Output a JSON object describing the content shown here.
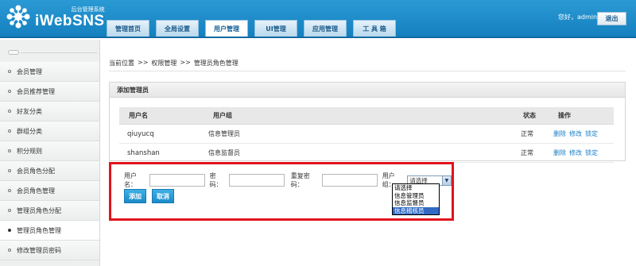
{
  "header": {
    "logo_sub": "后台管理系统",
    "logo_main": "iWebSNS",
    "tabs": [
      {
        "label": "管理首页"
      },
      {
        "label": "全局设置"
      },
      {
        "label": "用户管理"
      },
      {
        "label": "UI管理"
      },
      {
        "label": "应用管理"
      },
      {
        "label": "工 具 箱"
      }
    ],
    "active_tab": "用户管理",
    "greeting": "您好，admin",
    "logout_label": "退出"
  },
  "sidebar": {
    "items": [
      {
        "label": "会员管理"
      },
      {
        "label": "会员推荐管理"
      },
      {
        "label": "好友分类"
      },
      {
        "label": "群组分类"
      },
      {
        "label": "积分规则"
      },
      {
        "label": "会员角色分配"
      },
      {
        "label": "会员角色管理"
      },
      {
        "label": "管理员角色分配"
      },
      {
        "label": "管理员角色管理"
      },
      {
        "label": "修改管理员密码"
      }
    ],
    "active_item": "管理员角色管理"
  },
  "breadcrumb": {
    "current": "当前位置",
    "sep1": ">>",
    "level1": "权限管理",
    "sep2": ">>",
    "level2": "管理员角色管理"
  },
  "panel": {
    "title": "添加管理员",
    "columns": {
      "username": "用户名",
      "group": "用户组",
      "status": "状态",
      "actions": "操作"
    },
    "rows": [
      {
        "username": "qiuyucq",
        "group": "信息管理员",
        "status": "正常",
        "delete": "删除",
        "edit": "修改",
        "lock": "锁定"
      },
      {
        "username": "shanshan",
        "group": "信息监督员",
        "status": "正常",
        "delete": "删除",
        "edit": "修改",
        "lock": "锁定"
      }
    ]
  },
  "form": {
    "username_label": "用户名：",
    "password_label": "密码：",
    "repeat_password_label": "重复密码：",
    "group_label": "用户组：",
    "username_value": "",
    "password_value": "",
    "repeat_password_value": "",
    "group_selected": "请选择",
    "group_options": [
      {
        "label": "请选择"
      },
      {
        "label": "信息管理员"
      },
      {
        "label": "信息监督员"
      },
      {
        "label": "信息稽核员"
      }
    ],
    "highlighted_option": "信息稽核员",
    "add_label": "添加",
    "cancel_label": "取消"
  },
  "colors": {
    "header": "#1a8bcb",
    "highlight_box": "#e0141c",
    "link": "#1a7ec6",
    "option_highlight": "#316ac5"
  }
}
